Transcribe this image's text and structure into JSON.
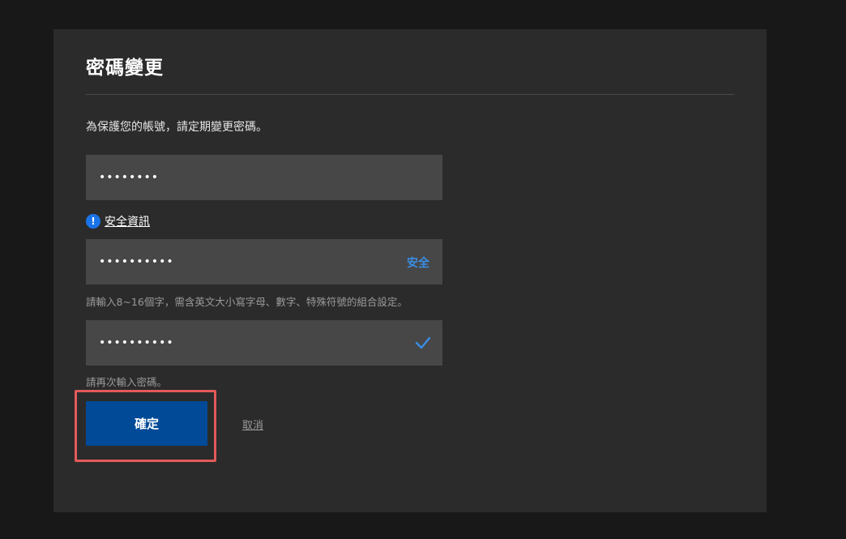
{
  "page": {
    "title": "密碼變更",
    "intro": "為保護您的帳號，請定期變更密碼。"
  },
  "current_password": {
    "value": "••••••••"
  },
  "security_info": {
    "icon": "info-icon",
    "icon_glyph": "!",
    "link_label": "安全資訊"
  },
  "new_password": {
    "value": "••••••••••",
    "strength_label": "安全",
    "strength_color": "#3a8ee6",
    "hint": "請輸入8~16個字，需含英文大小寫字母、數字、特殊符號的組合設定。"
  },
  "confirm_password": {
    "value": "••••••••••",
    "status_icon": "check-icon",
    "hint": "請再次輸入密碼。"
  },
  "actions": {
    "confirm_label": "確定",
    "confirm_color": "#004a97",
    "cancel_label": "取消"
  }
}
